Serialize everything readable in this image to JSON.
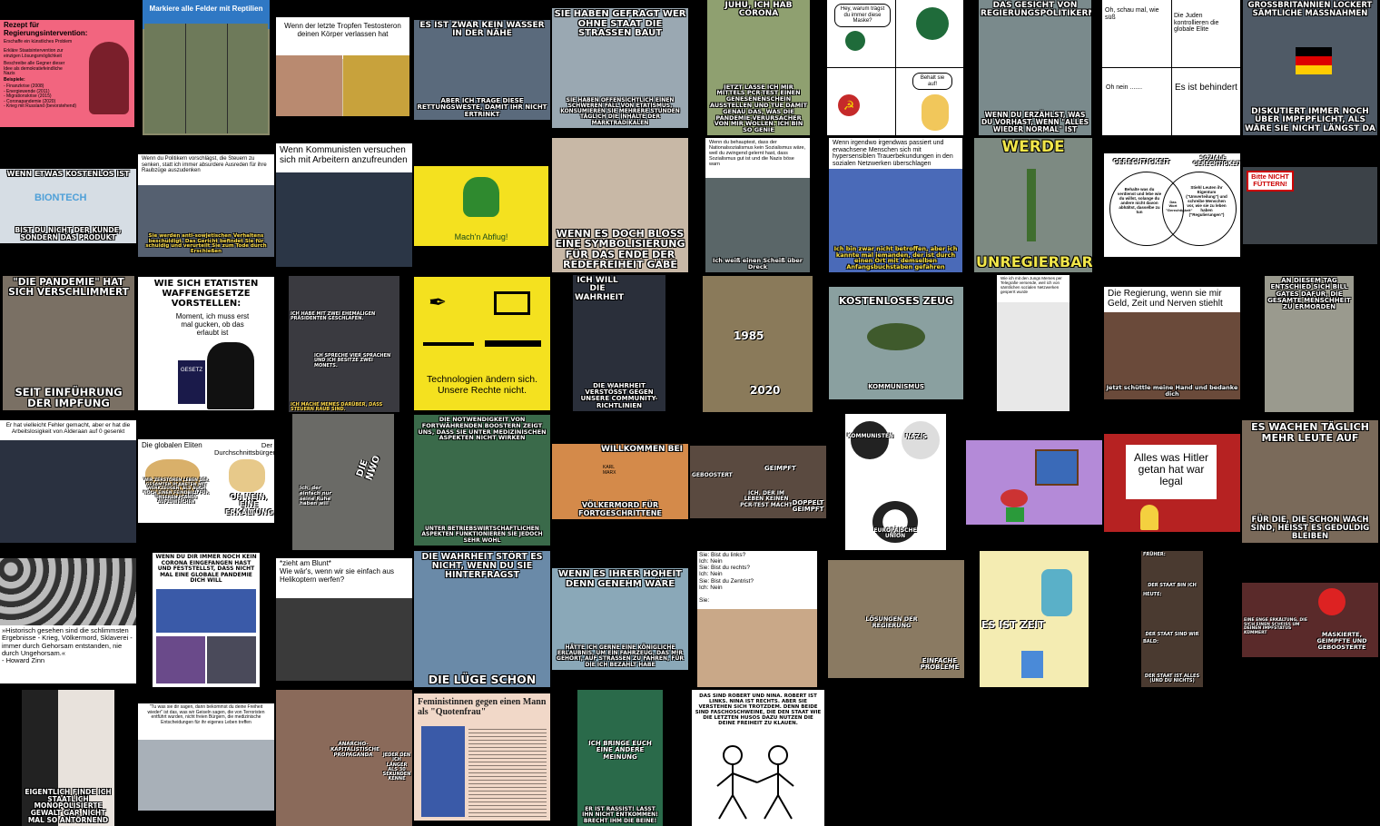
{
  "tiles": {
    "t01": {
      "title": "Rezept für Regierungsintervention:",
      "line1": "Erschaffe ein künstliches Problem",
      "line2": "Erkläre Staatsintervention zur einzigen Lösungsmöglichkeit",
      "line3": "Beschreibe alle Gegner dieser Idee als demokratiefeindliche Nazis",
      "examples_title": "Beispiele:",
      "examples": "- Finanzkrise (2008)\n- Energiewende (2011)\n- Migrationskrise (2015)\n- Coronapandemie (2020)\n- Krieg mit Russland (bevorstehend)"
    },
    "t02": {
      "caption": "Markiere alle Felder mit Reptilien"
    },
    "t03": {
      "caption": "Wenn der letzte Tropfen Testosteron deinen Körper verlassen hat"
    },
    "t04": {
      "top": "ES IST ZWAR KEIN WASSER IN DER NÄHE",
      "bottom": "ABER ICH TRAGE DIESE RETTUNGSWESTE, DAMIT IHR NICHT ERTRINKT"
    },
    "t05": {
      "top": "SIE HABEN GEFRAGT WER OHNE STAAT DIE STRASSEN BAUT",
      "bottom": "SIE HABEN OFFENSICHTLICH EINEN SCHWEREN FALL VON ETATISMUS, KONSUMIEREN SIE MEHRERE STUNDEN TÄGLICH DIE INHALTE DER MARKTRADIKALEN"
    },
    "t06": {
      "top": "JUHU, ICH HAB CORONA",
      "bottom": "JETZT LASSE ICH MIR MITTELS PCR-TEST EINEN GENESENENSCHEIN AUSSTELLEN UND TUE DAMIT GENAU DAS, WAS DIE PANDEMIE-VERURSACHER VON MIR WOLLEN. ICH BIN SO GENIE"
    },
    "t07": {
      "bubble1": "Hey, warum trägst du immer diese Maske?",
      "bubble2": "Behalt sie auf!"
    },
    "t08": {
      "top": "DAS GESICHT VON REGIERUNGSPOLITIKERN",
      "bottom": "WENN DU ERZÄHLST, WAS DU VORHAST, WENN \"ALLES WIEDER NORMAL\" IST"
    },
    "t09": {
      "p1": "Oh, schau mal, wie süß",
      "p2": "Die Juden kontrollieren die globale Elite",
      "p3": "Oh nein .......",
      "p4": "Es ist behindert"
    },
    "t10": {
      "top": "GROSSBRITANNIEN LOCKERT SÄMTLICHE MASSNAHMEN",
      "bottom": "DISKUTIERT IMMER NOCH ÜBER IMPFPFLICHT, ALS WÄRE SIE NICHT LÄNGST DA"
    },
    "t11": {
      "top": "WENN ETWAS KOSTENLOS IST",
      "brand": "BIONTECH",
      "bottom": "BIST DU NICHT DER KUNDE, SONDERN DAS PRODUKT"
    },
    "t12": {
      "caption": "Wenn du Politikern vorschlägst, die Steuern zu senken, statt ich immer absurdere Ausreden für ihre Raubzüge auszudenken",
      "bottom": "Sie werden anti-sowjetischen Verhaltens beschuldigt. Das Gericht befindet Sie für schuldig und verurteilt Sie zum Tode durch Erschießen"
    },
    "t13": {
      "caption": "Wenn Kommunisten versuchen sich mit Arbeitern anzufreunden"
    },
    "t14": {
      "caption": "Mach'n Abflug!"
    },
    "t15": {
      "bottom": "WENN ES DOCH BLOSS EINE SYMBOLISIERUNG FÜR DAS ENDE DER REDEFREIHEIT GÄBE"
    },
    "t16": {
      "caption": "Wenn du behauptest, dass der Nationalsozialismus kein Sozialismus wäre, weil du zwingend gelernt hast, dass Sozialismus gut ist und die Nazis böse warn",
      "bottom": "Ich weiß einen Scheiß über Dreck"
    },
    "t17": {
      "caption": "Wenn irgendwo irgendwas passiert und erwachsene Menschen sich mit hypersensiblen Trauerbekundungen in den sozialen Netzwerken überschlagen",
      "bottom": "Ich bin zwar nicht betroffen, aber ich kannte mal jemanden, der ist durch einen Ort mit demselben Anfangsbuchstaben gefahren"
    },
    "t18": {
      "top": "WERDE",
      "bottom": "UNREGIERBAR"
    },
    "t19": {
      "left": "GERECHTIGKEIT",
      "right": "SOZIALE GERECHTIGKEIT",
      "left_text": "Behalte was du verdienst und lebe wie du willst, solange du andere nicht davon abhältst, dasselbe zu tun",
      "center": "Das Wort \"Gerechtigkeit\"",
      "right_text": "Stiehl Leuten ihr Eigentum (\"Umverteilung\") und schreibe Menschen vor, wie sie zu leben haben (\"Regulierungen\")"
    },
    "t20": {
      "sign": "Bitte NICHT FÜTTERN!"
    },
    "t21": {
      "top": "\"DIE PANDEMIE\" HAT SICH VERSCHLIMMERT",
      "bottom": "SEIT EINFÜHRUNG DER IMPFUNG"
    },
    "t22": {
      "title": "WIE SICH ETATISTEN WAFFENGESETZE VORSTELLEN:",
      "speech": "Moment, ich muss erst mal gucken, ob das erlaubt ist",
      "book": "GESETZ"
    },
    "t23": {
      "p1": "Ich habe mit zwei ehemaligen Präsidenten geschlafen.",
      "p2": "Ich spreche vier Sprachen und ich besitze zwei Monets.",
      "p3": "Ich mache Memes darüber, dass Steuern Raub sind."
    },
    "t24": {
      "caption": "Technologien ändern sich.\nUnsere Rechte nicht."
    },
    "t25": {
      "top": "ICH WILL DIE WAHRHEIT",
      "bottom": "DIE WAHRHEIT VERSTÖSST GEGEN UNSERE COMMUNITY-RICHTLINIEN"
    },
    "t26": {
      "y1": "1985",
      "y2": "2020"
    },
    "t27": {
      "top": "KOSTENLOSES ZEUG",
      "bottom": "KOMMUNISMUS"
    },
    "t28": {
      "caption": "Wie ich mit den Jungs Memes per Telegrafie versende, weil ich von sämtlichen sozialen Netzwerken gesperrt wurde"
    },
    "t29": {
      "caption": "Die Regierung, wenn sie mir Geld, Zeit und Nerven stiehlt",
      "bottom": "Jetzt schüttle meine Hand und bedanke dich"
    },
    "t30": {
      "top": "AN DIESEM TAG ENTSCHIED SICH BILL GATES DAFÜR, DIE GESAMTE MENSCHHEIT ZU ERMORDEN"
    },
    "t31": {
      "caption": "Er hat vielleicht Fehler gemacht, aber er hat die Arbeitslosigkeit von Alderaan auf 0 gesenkt"
    },
    "t32": {
      "left": "Die globalen Eliten",
      "right": "Der Durchschnittsbürger",
      "left_bottom": "WIR ZERSTÖREN LEBEN DER GESAMTEN PLANETEN MIT WERKZEUGEN, ALS AUCH NOCH EINEN FEINDBILD FÜR UNSEREN PLÄNEN AUFZUWEICHEN",
      "right_bottom": "OH NEIN, EINE ERKÄLTUNG"
    },
    "t33": {
      "tag1": "Die NWO",
      "tag2": "Ich, der einfach nur seine Ruhe haben will"
    },
    "t34": {
      "top": "DIE NOTWENDIGKEIT VON FORTWÄHRENDEN BOOSTERN ZEIGT UNS, DASS SIE UNTER MEDIZINISCHEN ASPEKTEN NICHT WIRKEN",
      "bottom": "UNTER BETRIEBSWIRTSCHAFTLICHEN ASPEKTEN FUNKTIONIEREN SIE JEDOCH SEHR WOHL"
    },
    "t35": {
      "top": "WILLKOMMEN BEI",
      "name": "KARL MARX",
      "bottom": "VÖLKERMORD FÜR FORTGESCHRITTENE"
    },
    "t36": {
      "l1": "GEBOOSTERT",
      "l2": "GEIMPFT",
      "l3": "ICH, DER IM LEBEN KEINEN PCR-TEST MACHT",
      "l4": "DOPPELT GEIMPFT"
    },
    "t37": {
      "l1": "KOMMUNISTEN",
      "l2": "NAZIS",
      "l3": "EUROPÄISCHE UNION"
    },
    "t38": {},
    "t39": {
      "board": "Alles was Hitler getan hat war legal"
    },
    "t40": {
      "top": "ES WACHEN TÄGLICH MEHR LEUTE AUF",
      "bottom": "FÜR DIE, DIE SCHON WACH SIND, HEISST ES GEDULDIG BLEIBEN"
    },
    "t41": {
      "caption": "»Historisch gesehen sind die schlimmsten Ergebnisse - Krieg, Völkermord, Sklaverei - immer durch Gehorsam entstanden, nie durch Ungehorsam.«\n- Howard Zinn"
    },
    "t42": {
      "top": "WENN DU DIR IMMER NOCH KEIN CORONA EINGEFANGEN HAST UND FESTSTELLST, DASS NICHT MAL EINE GLOBALE PANDEMIE DICH WILL"
    },
    "t43": {
      "caption": "*zieht am Blunt*\nWie wär's, wenn wir sie einfach aus Helikoptern werfen?"
    },
    "t44": {
      "top": "DIE WAHRHEIT STÖRT ES NICHT, WENN DU SIE HINTERFRAGST",
      "bottom": "DIE LÜGE SCHON"
    },
    "t45": {
      "top": "WENN ES IHRER HOHEIT DENN GENEHM WÄRE",
      "bottom": "HÄTTE ICH GERNE EINE KÖNIGLICHE ERLAUBNIS, UM EIN FAHRZEUG, DAS MIR GEHÖRT, AUF STRASSEN ZU FAHREN, FÜR DIE ICH BEZAHLT HABE"
    },
    "t46": {
      "caption": "Sie: Bist du links?\nIch: Nein\nSie: Bist du rechts?\nIch: Nein\nSie: Bist du Zentrist?\nIch: Nein\n\nSie:"
    },
    "t47": {
      "l1": "LÖSUNGEN DER REGIERUNG",
      "l2": "EINFACHE PROBLEME"
    },
    "t48": {
      "caption": "ES IST ZEIT"
    },
    "t49": {
      "l1": "FRÜHER:",
      "l2": "DER STAAT BIN ICH",
      "l3": "HEUTE:",
      "l4": "DER STAAT SIND WIR",
      "l5": "BALD:",
      "l6": "DER STAAT IST ALLES (UND DU NICHTS)"
    },
    "t50": {
      "l1": "EINE ENGE ERKÄLTUNG, DIE SICH EINEN SCHEISS UM DEINEN IMPFSTATUS KÜMMERT",
      "l2": "MASKIERTE, GEIMPFTE UND GEBOOSTERTE"
    },
    "t51": {
      "bottom": "EIGENTLICH FINDE ICH STAATLICH MONOPOLISIERTE GEWALT GAR NICHT MAL SO ANTÖRNEND"
    },
    "t52": {
      "caption": "\"Tu was sie dir sagen, dann bekommst du deine Freiheit wieder\" ist das, was wir Geiseln sagen, die von Terroristen entführt wurden, nicht freien Bürgern, die medizinische Entscheidungen für ihr eigenes Leben treffen"
    },
    "t53": {
      "l1": "anarcho-kapitalistische Propaganda",
      "l2": "Jeder den ich länger als 30 Sekunden kenne"
    },
    "t54": {
      "title": "Feministinnen gegen einen Mann als \"Quotenfrau\""
    },
    "t55": {
      "top": "ICH BRINGE EUCH EINE ANDERE MEINUNG",
      "bottom": "ER IST RASSIST! LASST IHN NICHT ENTKOMMEN! BRECHT IHM DIE BEINE!"
    },
    "t56": {
      "caption": "DAS SIND ROBERT UND NINA. ROBERT IST LINKS. NINA IST RECHTS. ABER SIE VERSTEHEN SICH TROTZDEM. DENN BEIDE SIND FASCHOSCHWEINE, DIE DEN STAAT WIE DIE LETZTEN HUSOS DAZU NUTZEN DIE DEINE FREIHEIT ZU KLAUEN."
    }
  },
  "colors": {
    "background": "#000000",
    "yellow": "#f4e11f",
    "green_flag": "#bcd52a",
    "pink": "#f2657f",
    "blue_banner": "#2f78c4"
  }
}
